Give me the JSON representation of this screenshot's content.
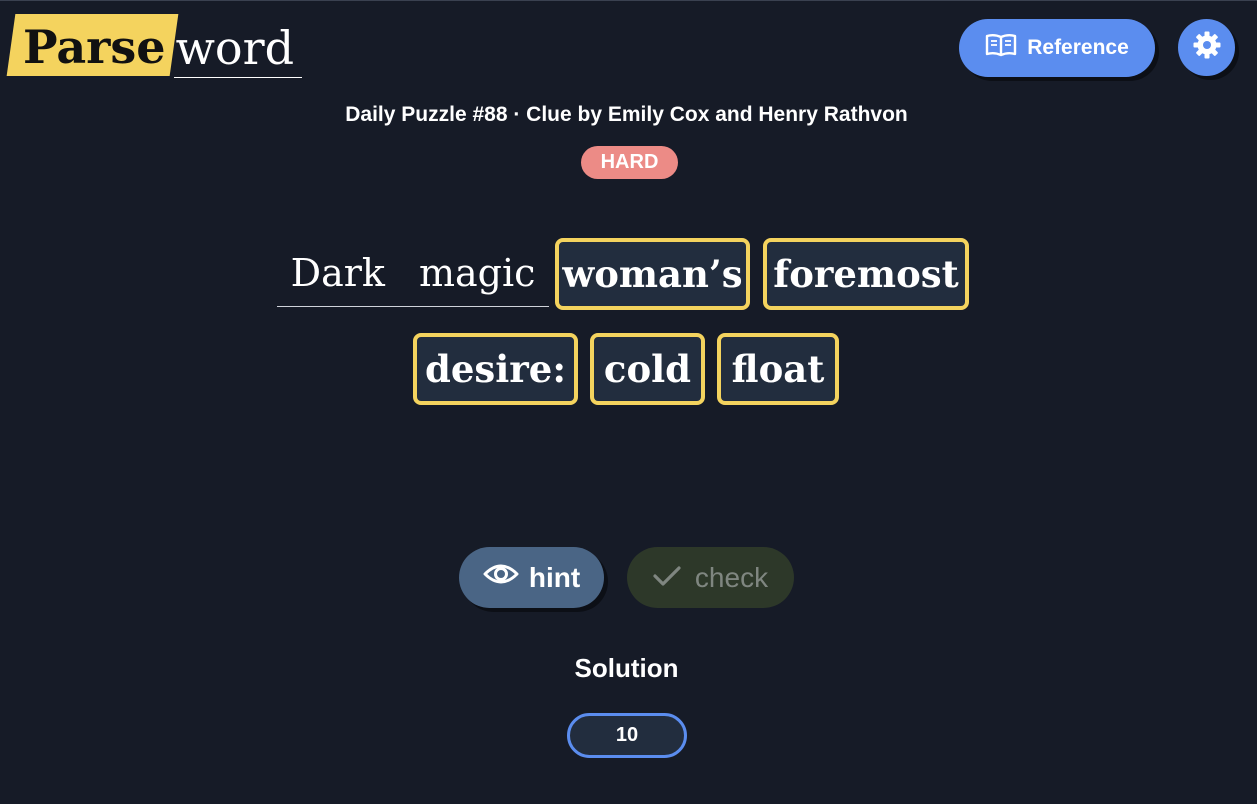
{
  "logo": {
    "part1": "Parse",
    "part2": "word"
  },
  "header": {
    "reference_label": "Reference"
  },
  "icons": {
    "reference": "book-icon",
    "settings": "gear-icon",
    "hint": "eye-icon",
    "check": "checkmark-icon"
  },
  "puzzle": {
    "subtitle": "Daily Puzzle #88 · Clue by Emily Cox and Henry Rathvon",
    "difficulty": "HARD"
  },
  "clue": {
    "plain_words": [
      "Dark",
      "magic"
    ],
    "tiles": [
      "woman’s",
      "foremost",
      "desire:",
      "cold",
      "float"
    ]
  },
  "actions": {
    "hint_label": "hint",
    "check_label": "check"
  },
  "solution": {
    "title": "Solution",
    "length": "10"
  },
  "colors": {
    "background": "#161b27",
    "accent_yellow": "#f4d35e",
    "accent_blue": "#5b8def",
    "badge_red": "#ec8b86",
    "tile_bg": "#222d3e",
    "hint_bg": "#4a6585",
    "check_bg": "#2d3829"
  }
}
